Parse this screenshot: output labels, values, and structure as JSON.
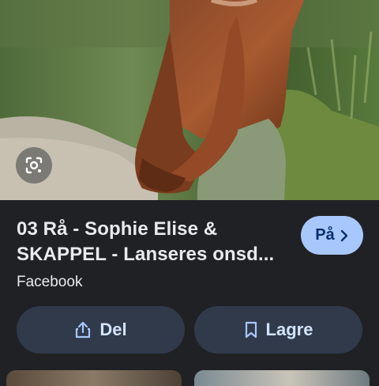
{
  "result": {
    "title_line1": "03 Rå - Sophie Elise &",
    "title_line2": "SKAPPEL - Lanseres onsd...",
    "source": "Facebook"
  },
  "buttons": {
    "visit_label": "På",
    "share_label": "Del",
    "save_label": "Lagre"
  },
  "icons": {
    "lens": "google-lens-icon",
    "visit": "chevron-right-icon",
    "share": "share-icon",
    "save": "bookmark-icon"
  },
  "colors": {
    "background": "#202124",
    "visit_button": "#a8c7fa",
    "action_button": "#303a4b",
    "action_text": "#d3e3fd",
    "text": "#e8eaed"
  }
}
